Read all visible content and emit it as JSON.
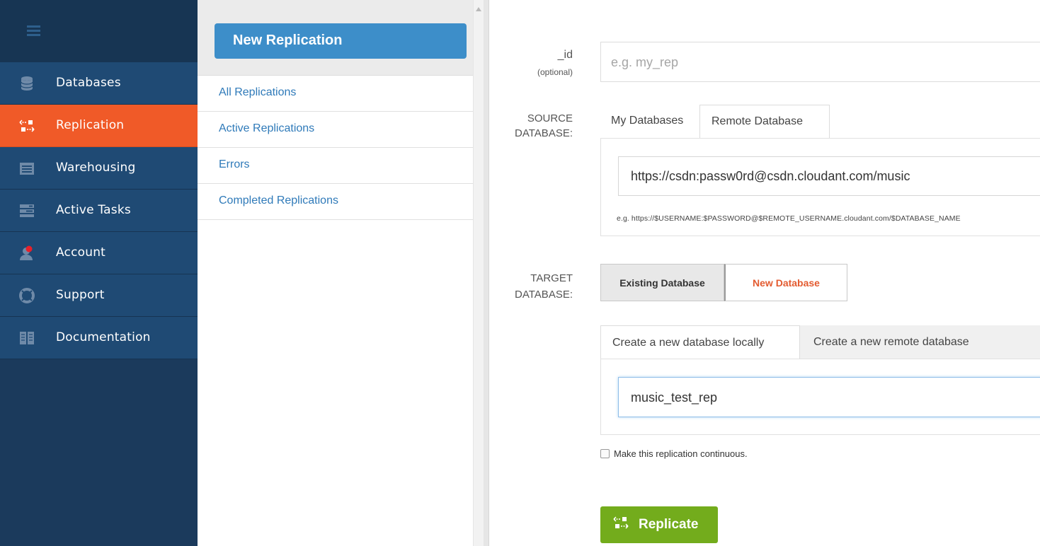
{
  "sidebar": {
    "items": [
      {
        "label": "Databases",
        "icon": "database-icon",
        "active": false
      },
      {
        "label": "Replication",
        "icon": "replication-icon",
        "active": true
      },
      {
        "label": "Warehousing",
        "icon": "warehouse-icon",
        "active": false
      },
      {
        "label": "Active Tasks",
        "icon": "tasks-icon",
        "active": false
      },
      {
        "label": "Account",
        "icon": "account-icon",
        "active": false
      },
      {
        "label": "Support",
        "icon": "lifebuoy-icon",
        "active": false
      },
      {
        "label": "Documentation",
        "icon": "book-icon",
        "active": false
      }
    ]
  },
  "middle": {
    "new_button": "New Replication",
    "links": [
      "All Replications",
      "Active Replications",
      "Errors",
      "Completed Replications"
    ]
  },
  "form": {
    "id_label": "_id",
    "id_sublabel": "(optional)",
    "id_placeholder": "e.g. my_rep",
    "source_label_1": "SOURCE",
    "source_label_2": "DATABASE:",
    "source_tabs": [
      "My Databases",
      "Remote Database"
    ],
    "source_value": "https://csdn:passw0rd@csdn.cloudant.com/music",
    "source_hint": "e.g. https://$USERNAME:$PASSWORD@$REMOTE_USERNAME.cloudant.com/$DATABASE_NAME",
    "target_label_1": "TARGET",
    "target_label_2": "DATABASE:",
    "target_options": [
      "Existing Database",
      "New Database"
    ],
    "target_tabs": [
      "Create a new database locally",
      "Create a new remote database"
    ],
    "target_value": "music_test_rep",
    "continuous_label": "Make this replication continuous.",
    "replicate_button": "Replicate"
  },
  "colors": {
    "sidebar_bg": "#1f4a74",
    "active_accent": "#f05a28",
    "primary_button": "#3d8ec9",
    "replicate_button": "#73ac1c",
    "link": "#2f7ab9"
  }
}
